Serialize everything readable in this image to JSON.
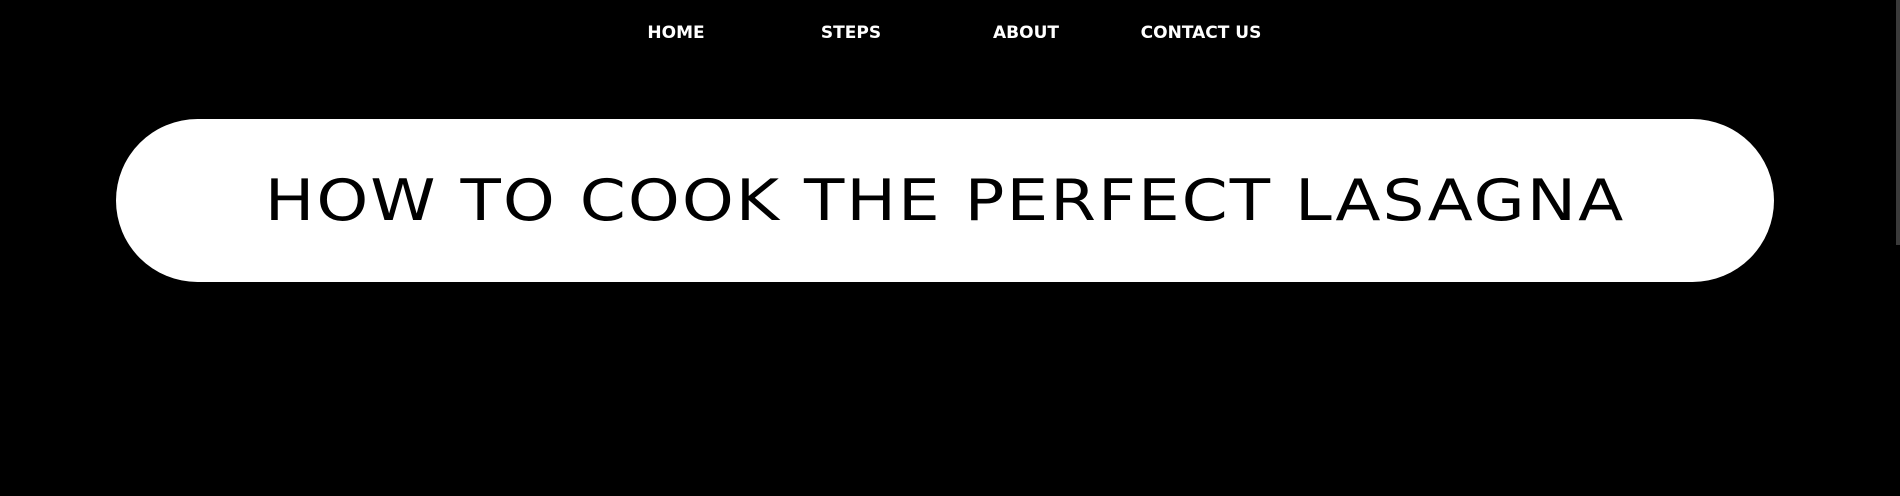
{
  "nav": {
    "items": [
      {
        "label": "HOME"
      },
      {
        "label": "STEPS"
      },
      {
        "label": "ABOUT"
      },
      {
        "label": "CONTACT US"
      }
    ]
  },
  "hero": {
    "title": "HOW TO COOK THE PERFECT LASAGNA"
  },
  "colors": {
    "background": "#000000",
    "nav_text": "#ffffff",
    "hero_background": "#ffffff",
    "hero_text": "#000000"
  }
}
